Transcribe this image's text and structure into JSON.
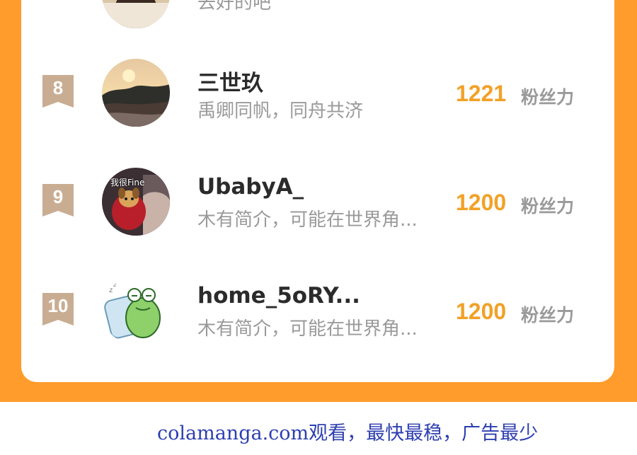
{
  "partial_row": {
    "bio": "去好的吧"
  },
  "rows": [
    {
      "rank": "8",
      "name": "三世玖",
      "bio": "禹卿同帆，同舟共济",
      "score": "1221",
      "unit": "粉丝力"
    },
    {
      "rank": "9",
      "name": "UbabyA_",
      "bio": "木有简介，可能在世界角...",
      "score": "1200",
      "unit": "粉丝力",
      "avatar_tag": "我很Fine"
    },
    {
      "rank": "10",
      "name": "home_5oRY...",
      "bio": "木有简介，可能在世界角...",
      "score": "1200",
      "unit": "粉丝力"
    }
  ],
  "footer": {
    "text": "colamanga.com观看，最快最稳，广告最少"
  },
  "colors": {
    "accent_orange": "#ff9c2b",
    "score_color": "#f2a126",
    "badge_color": "#c9ad92",
    "footer_link": "#2d3fb0"
  },
  "icons": [
    "rank-ribbon-icon",
    "avatar-sunset",
    "avatar-dog-fine",
    "avatar-frog-pillow"
  ]
}
